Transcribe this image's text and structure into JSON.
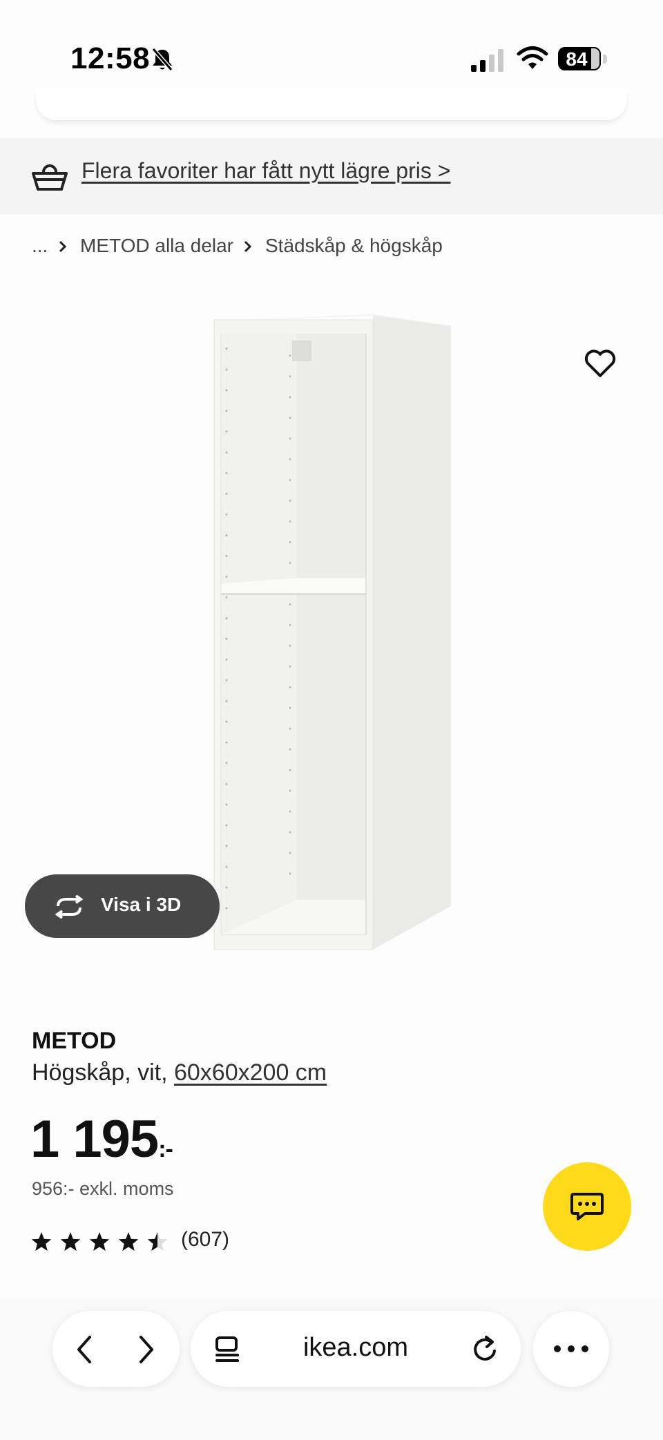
{
  "status_bar": {
    "time": "12:58",
    "battery": "84"
  },
  "promo": {
    "text": "Flera favoriter har fått nytt lägre pris >"
  },
  "breadcrumb": {
    "items": [
      "...",
      "METOD alla delar",
      "Städskåp & högskåp"
    ]
  },
  "product": {
    "view3d_label": "Visa i 3D",
    "name": "METOD",
    "desc_prefix": "Högskåp, vit, ",
    "size": "60x60x200 cm",
    "price": "1 195",
    "price_suffix": ":-",
    "price_ex_vat": "956:- exkl. moms",
    "rating": 4.5,
    "review_count": "(607)"
  },
  "browser": {
    "url": "ikea.com"
  },
  "icons": {
    "status": [
      "bell-slash-icon",
      "signal-icon",
      "wifi-icon",
      "battery-icon"
    ],
    "promo": "basket-icon",
    "favorite": "heart-icon",
    "view3d": "rotate-icon",
    "chat": "chat-icon",
    "toolbar": [
      "chevron-left-icon",
      "chevron-right-icon",
      "reader-icon",
      "reload-icon",
      "more-icon"
    ]
  },
  "colors": {
    "chat_button": "#ffda1a",
    "view3d_button": "#474747",
    "promo_bg": "#f4f4f4"
  }
}
